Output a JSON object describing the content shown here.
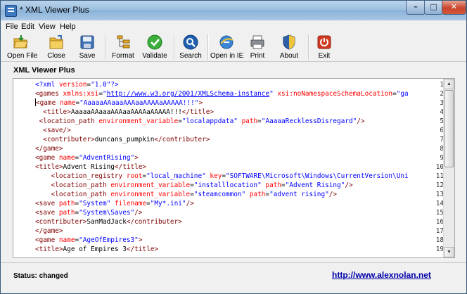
{
  "window": {
    "title": "* XML Viewer Plus",
    "minimize_glyph": "–",
    "maximize_glyph": "□",
    "close_glyph": "✕"
  },
  "menu": [
    "File",
    "Edit",
    "View",
    "Help"
  ],
  "toolbar": [
    {
      "label": "Open File",
      "icon": "open-folder-icon"
    },
    {
      "label": "Close",
      "icon": "close-folder-icon"
    },
    {
      "label": "Save",
      "icon": "floppy-disk-icon"
    },
    {
      "label": "Format",
      "icon": "format-tree-icon"
    },
    {
      "label": "Validate",
      "icon": "green-check-icon"
    },
    {
      "label": "Search",
      "icon": "magnifier-icon"
    },
    {
      "label": "Open in IE",
      "icon": "ie-globe-icon"
    },
    {
      "label": "Print",
      "icon": "printer-icon"
    },
    {
      "label": "About",
      "icon": "shield-info-icon"
    },
    {
      "label": "Exit",
      "icon": "power-icon"
    }
  ],
  "panel_title": "XML Viewer Plus",
  "editor": {
    "current_line": 3,
    "lines": [
      "<?xml version=\"1.0\"?>",
      "<games xmlns:xsi=\"http://www.w3.org/2001/XMLSchema-instance\" xsi:noNamespaceSchemaLocation=\"ga",
      "<game name=\"AaaaaAAaaaAAAaaAAAAaAAAAA!!!\">",
      "  <title>AaaaaAAaaaAAAaaAAAAaAAAAA!!!</title>",
      " <location_path environment_variable=\"localappdata\" path=\"AaaaaRecklessDisregard\"/>",
      "  <save/>",
      "  <contributer>duncans_pumpkin</contributer>",
      "</game>",
      "<game name=\"AdventRising\">",
      "<title>Advent Rising</title>",
      "    <location_registry root=\"local_machine\" key=\"SOFTWARE\\Microsoft\\Windows\\CurrentVersion\\Uni",
      "    <location_path environment_variable=\"installlocation\" path=\"Advent Rising\"/>",
      "    <location_path environment_variable=\"steamcommon\" path=\"advent rising\"/>",
      "<save path=\"System\" filename=\"My*.ini\"/>",
      "<save path=\"System\\Saves\"/>",
      "<contributer>SanMadJack</contributer>",
      "</game>",
      "<game name=\"AgeOfEmpires3\">",
      "<title>Age of Empires 3</title>"
    ]
  },
  "status": {
    "text": "Status: changed",
    "link": "http://www.alexnolan.net"
  }
}
